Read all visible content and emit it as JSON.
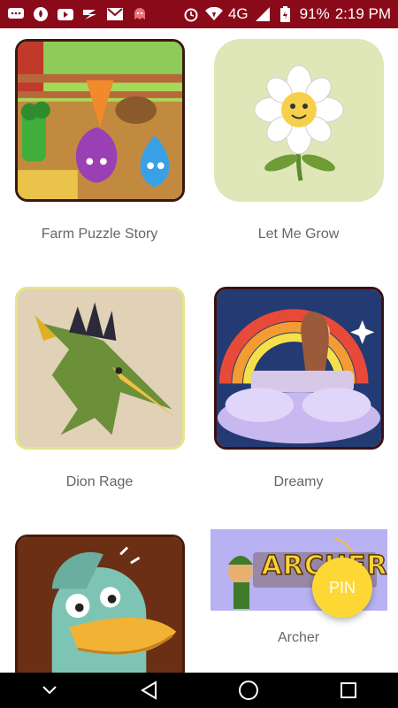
{
  "status_bar": {
    "battery": "91%",
    "time": "2:19 PM",
    "network": "4G"
  },
  "apps": [
    {
      "name": "Farm Puzzle Story",
      "icon": "farm-puzzle-story-icon"
    },
    {
      "name": "Let Me Grow",
      "icon": "let-me-grow-icon"
    },
    {
      "name": "Dion Rage",
      "icon": "dion-rage-icon"
    },
    {
      "name": "Dreamy",
      "icon": "dreamy-icon"
    },
    {
      "name": "",
      "icon": "duck-game-icon"
    },
    {
      "name": "Archer",
      "icon": "archer-icon",
      "banner_text": "ARCHER"
    }
  ],
  "fab": {
    "label": "PIN"
  },
  "colors": {
    "status_bar": "#8b0a1a",
    "fab": "#fdd835",
    "nav_bar": "#000000"
  }
}
